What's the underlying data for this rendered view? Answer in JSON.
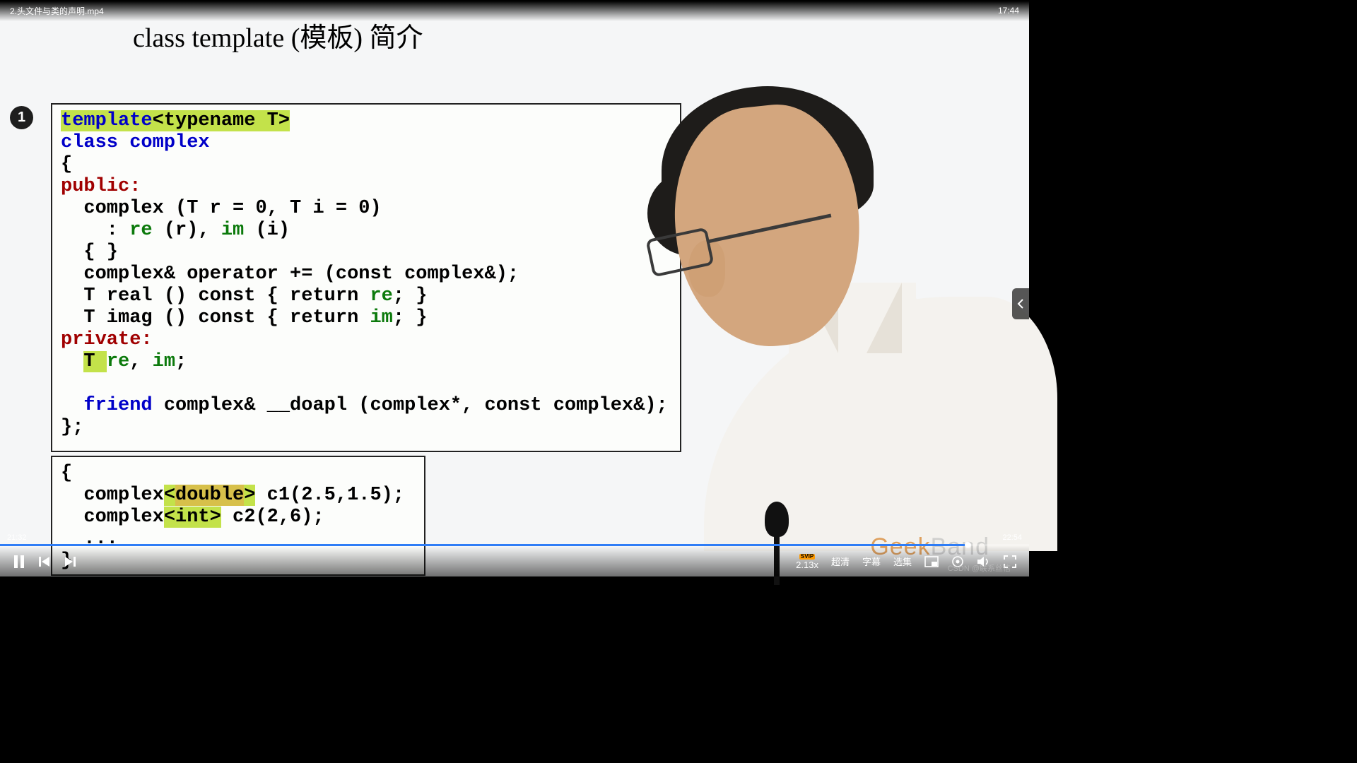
{
  "topbar": {
    "filename": "2.头文件与类的声明.mp4",
    "duration_display": "17:44"
  },
  "slide": {
    "title_en": "class template ",
    "title_cn": "(模板) 简介",
    "marker": "1"
  },
  "code1": {
    "l1a": "template",
    "l1b": "<typename T>",
    "l2a": "class ",
    "l2b": "complex",
    "l3": "{",
    "l4": "public:",
    "l5": "  complex (T r = 0, T i = 0)",
    "l6a": "    : ",
    "l6b": "re",
    "l6c": " (r), ",
    "l6d": "im",
    "l6e": " (i)",
    "l7": "  { }",
    "l8": "  complex& operator += (const complex&);",
    "l9a": "  T real () const { return ",
    "l9b": "re",
    "l9c": "; }",
    "l10a": "  T imag () const { return ",
    "l10b": "im",
    "l10c": "; }",
    "l11": "private:",
    "l12a": "  ",
    "l12b": "T ",
    "l12c": "re",
    "l12d": ", ",
    "l12e": "im",
    "l12f": ";",
    "l13": "",
    "l14a": "  ",
    "l14b": "friend",
    "l14c": " complex& __doapl (complex*, const complex&);",
    "l15": "};"
  },
  "code2": {
    "l1": "{",
    "l2a": "  complex",
    "l2b": "<",
    "l2c": "double",
    "l2d": ">",
    "l2e": " c1(2.5,1.5);",
    "l3a": "  complex",
    "l3b": "<",
    "l3c": "int",
    "l3d": ">",
    "l3e": " c2(2,6);",
    "l4": "  ...",
    "l5": "}"
  },
  "brand": {
    "geek": "Geek",
    "band": "Band"
  },
  "progress": {
    "played_pct": 94,
    "elapsed": "21:32",
    "total": "22:54"
  },
  "controls": {
    "speed_tag": "SVIP",
    "speed": "2.13x",
    "quality": "超清",
    "subtitle": "字幕",
    "episodes": "选集"
  },
  "watermark": "CSDN @联系丝信"
}
